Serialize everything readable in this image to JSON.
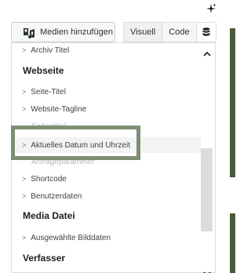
{
  "toolbar": {
    "media_button_label": "Medien hinzufügen",
    "tab_visual": "Visuell",
    "tab_code": "Code"
  },
  "dropdown": {
    "top_item": "Archiv Titel",
    "groups": [
      {
        "heading": "Webseite",
        "items": [
          "Seite-Titel",
          "Website-Tagline",
          "Seitentitel",
          "Aktuelles Datum und Uhrzeit",
          "Anfrageparameter",
          "Shortcode",
          "Benutzerdaten"
        ]
      },
      {
        "heading": "Media Datei",
        "items": [
          "Ausgewählte Bilddaten"
        ]
      },
      {
        "heading": "Verfasser",
        "items": []
      }
    ],
    "selected_item": "Aktuelles Datum und Uhrzeit"
  },
  "icons": {
    "sparkle": "sparkle-icon",
    "media": "media-icon",
    "database": "database-icon",
    "scroll_up": "chevron-up-icon",
    "scroll_down": "chevron-down-icon"
  },
  "colors": {
    "focus_outline": "#7d8f72",
    "highlight": "#f3f3f3",
    "scroll_thumb": "#dcdcde"
  }
}
